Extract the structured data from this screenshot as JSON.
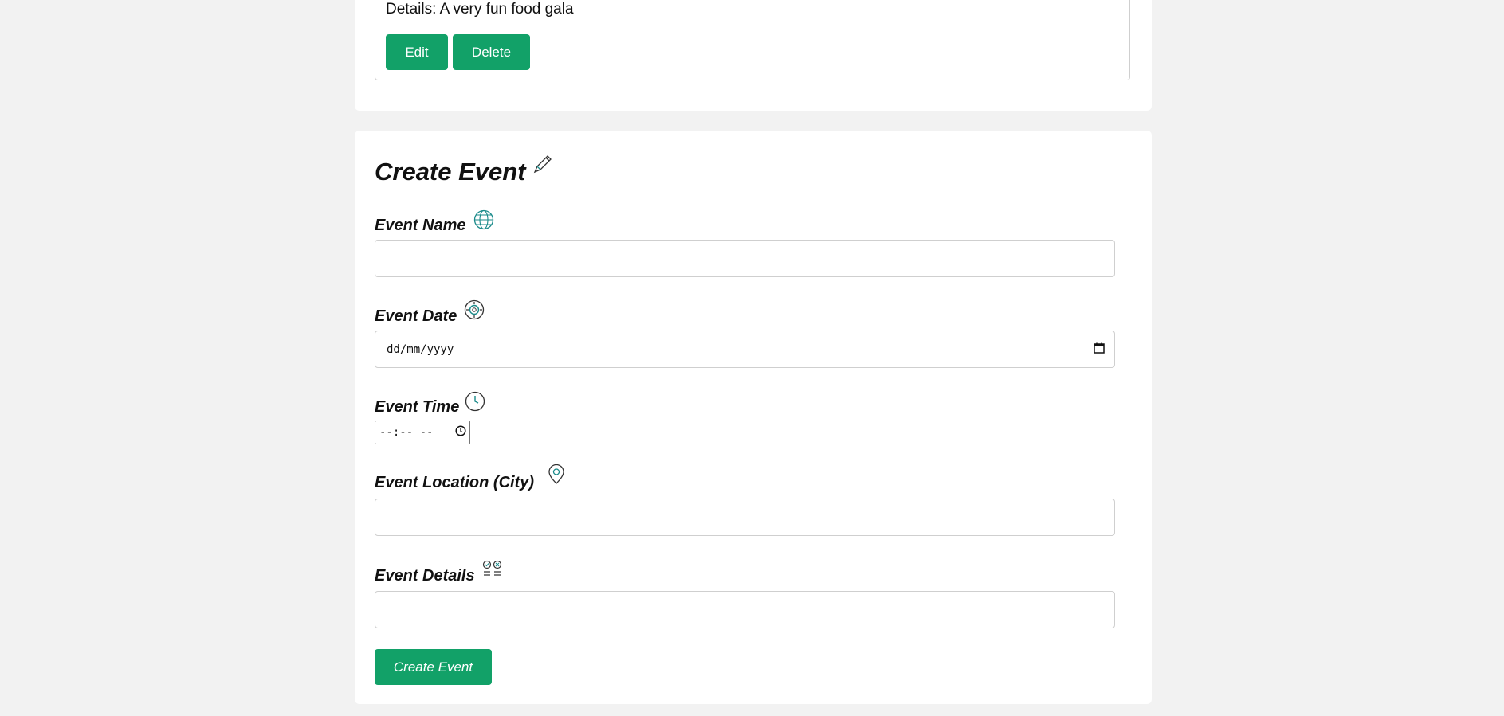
{
  "event_card": {
    "details_text": "Details: A very fun food gala",
    "edit_label": "Edit",
    "delete_label": "Delete"
  },
  "form": {
    "title": "Create Event",
    "name_label": "Event Name",
    "name_value": "",
    "date_label": "Event Date",
    "date_placeholder": "dd/mm/yyyy",
    "time_label": "Event Time",
    "time_placeholder": "--:-- --",
    "location_label": "Event Location (City)",
    "location_value": "",
    "details_label": "Event Details",
    "details_value": "",
    "submit_label": "Create Event"
  },
  "icons": {
    "title": "pencil-icon",
    "name": "globe-icon",
    "date": "settings-dial-icon",
    "time": "clock-icon",
    "location": "map-pin-icon",
    "details": "checklist-icon",
    "date_picker": "calendar-icon",
    "time_picker": "clock-icon"
  },
  "colors": {
    "accent": "#12a168",
    "icon_teal": "#1a8a8a",
    "background": "#f2f2f2",
    "card": "#ffffff"
  }
}
